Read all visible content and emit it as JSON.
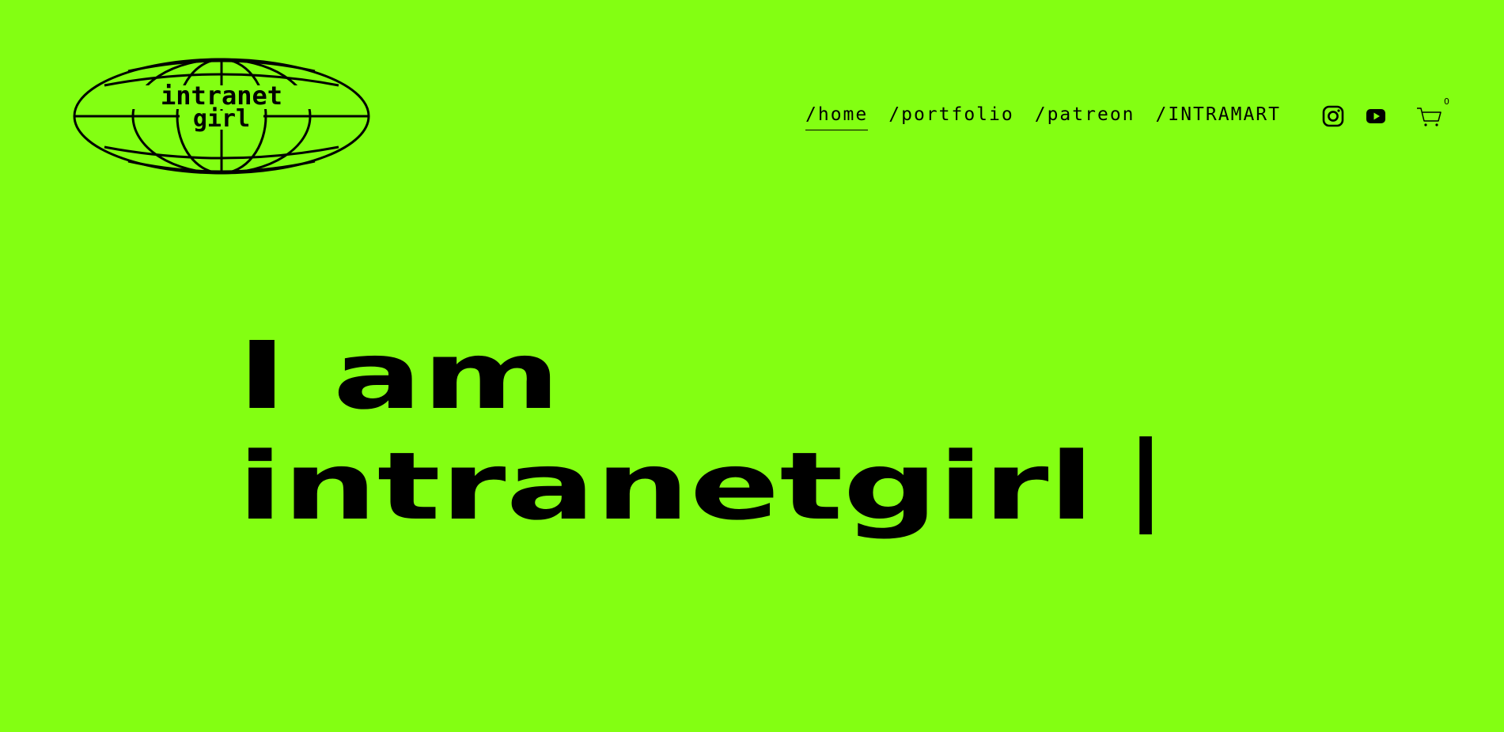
{
  "brand": {
    "logo_text_line1": "intranet",
    "logo_text_line2": "girl"
  },
  "nav": {
    "items": [
      {
        "label": "/home",
        "active": true
      },
      {
        "label": "/portfolio",
        "active": false
      },
      {
        "label": "/patreon",
        "active": false
      },
      {
        "label": "/INTRAMART",
        "active": false
      }
    ]
  },
  "social": {
    "instagram": "instagram-icon",
    "youtube": "youtube-icon"
  },
  "cart": {
    "count": "0",
    "icon": "cart-icon"
  },
  "hero": {
    "line1": "I am",
    "line2": "intranetgirl"
  },
  "colors": {
    "background": "#83ff12",
    "foreground": "#000000"
  }
}
